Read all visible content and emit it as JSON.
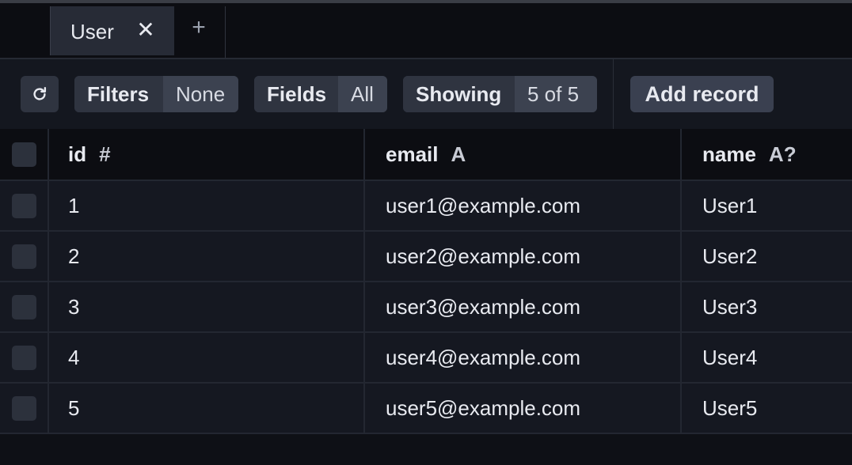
{
  "tabs": {
    "active": {
      "label": "User",
      "close": "✕"
    },
    "add": "+"
  },
  "toolbar": {
    "refresh_icon": "refresh-icon",
    "filters": {
      "label": "Filters",
      "value": "None"
    },
    "fields": {
      "label": "Fields",
      "value": "All"
    },
    "showing": {
      "label": "Showing",
      "value": "5 of 5"
    },
    "add_record": "Add record"
  },
  "table": {
    "columns": [
      {
        "name": "id",
        "type": "#"
      },
      {
        "name": "email",
        "type": "A"
      },
      {
        "name": "name",
        "type": "A?"
      }
    ],
    "rows": [
      {
        "id": "1",
        "email": "user1@example.com",
        "name": "User1"
      },
      {
        "id": "2",
        "email": "user2@example.com",
        "name": "User2"
      },
      {
        "id": "3",
        "email": "user3@example.com",
        "name": "User3"
      },
      {
        "id": "4",
        "email": "user4@example.com",
        "name": "User4"
      },
      {
        "id": "5",
        "email": "user5@example.com",
        "name": "User5"
      }
    ]
  },
  "colors": {
    "background": "#0e1016",
    "toolbar": "#14171f",
    "row": "#151821",
    "button": "#2f3440"
  }
}
